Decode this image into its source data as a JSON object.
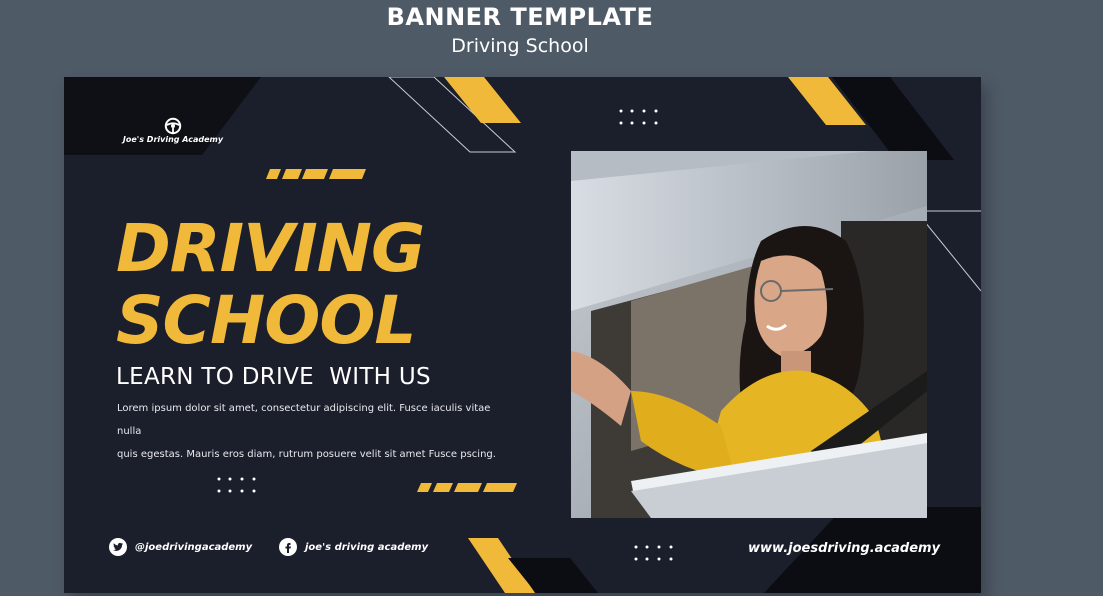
{
  "header": {
    "title": "BANNER TEMPLATE",
    "subtitle": "Driving School"
  },
  "banner": {
    "logo_text": "Joe's Driving Academy",
    "headline_line1": "DRIVING",
    "headline_line2": "SCHOOL",
    "tagline": "LEARN TO DRIVE  WITH US",
    "body_line1": "Lorem ipsum dolor sit amet, consectetur adipiscing elit. Fusce iaculis vitae nulla",
    "body_line2": "quis egestas. Mauris eros diam, rutrum posuere velit sit amet Fusce pscing.",
    "twitter_handle": "@joedrivingacademy",
    "facebook_handle": "joe's driving academy",
    "website": "www.joesdriving.academy"
  },
  "colors": {
    "background": "#4f5a67",
    "banner_bg": "#1b1e2b",
    "accent": "#f0b93a",
    "text": "#ffffff"
  },
  "icons": [
    "steering-wheel-icon",
    "twitter-icon",
    "facebook-icon"
  ]
}
